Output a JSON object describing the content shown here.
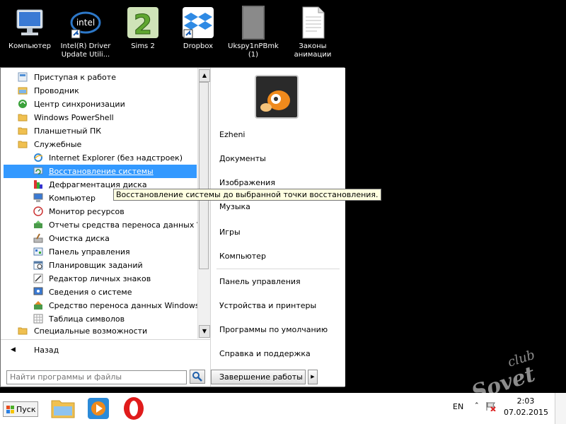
{
  "desktop": {
    "icons": [
      {
        "label": "Компьютер",
        "icon": "computer-icon"
      },
      {
        "label": "Intel(R) Driver\nUpdate Utili...",
        "icon": "intel-icon"
      },
      {
        "label": "Sims 2",
        "icon": "sims2-icon"
      },
      {
        "label": "Dropbox",
        "icon": "dropbox-icon"
      },
      {
        "label": "Ukspy1nPBmk\n(1)",
        "icon": "image-file-icon"
      },
      {
        "label": "Законы\nанимации",
        "icon": "document-icon"
      }
    ]
  },
  "start_menu": {
    "programs": [
      {
        "label": "Приступая к работе",
        "icon": "getting-started-icon"
      },
      {
        "label": "Проводник",
        "icon": "explorer-folder-icon"
      },
      {
        "label": "Центр синхронизации",
        "icon": "sync-center-icon"
      },
      {
        "label": "Windows PowerShell",
        "icon": "folder-icon"
      },
      {
        "label": "Планшетный ПК",
        "icon": "folder-icon"
      },
      {
        "label": "Служебные",
        "icon": "folder-icon"
      },
      {
        "label": "Internet Explorer (без надстроек)",
        "icon": "ie-icon"
      },
      {
        "label": "Восстановление системы",
        "icon": "system-restore-icon"
      },
      {
        "label": "Дефрагментация диска",
        "icon": "defrag-icon"
      },
      {
        "label": "Компьютер",
        "icon": "computer-icon"
      },
      {
        "label": "Монитор ресурсов",
        "icon": "resource-monitor-icon"
      },
      {
        "label": "Отчеты средства переноса данных Wir",
        "icon": "transfer-report-icon"
      },
      {
        "label": "Очистка диска",
        "icon": "disk-cleanup-icon"
      },
      {
        "label": "Панель управления",
        "icon": "control-panel-icon"
      },
      {
        "label": "Планировщик заданий",
        "icon": "task-scheduler-icon"
      },
      {
        "label": "Редактор личных знаков",
        "icon": "char-editor-icon"
      },
      {
        "label": "Сведения о системе",
        "icon": "system-info-icon"
      },
      {
        "label": "Средство переноса данных Windows",
        "icon": "easy-transfer-icon"
      },
      {
        "label": "Таблица символов",
        "icon": "char-map-icon"
      },
      {
        "label": "Специальные возможности",
        "icon": "folder-icon"
      }
    ],
    "back_label": "Назад",
    "search_placeholder": "Найти программы и файлы",
    "tooltip": "Восстановление системы до выбранной точки восстановления.",
    "right_items": [
      "Ezheni",
      "Документы",
      "Изображения",
      "Музыка",
      "Игры",
      "Компьютер",
      "Панель управления",
      "Устройства и принтеры",
      "Программы по умолчанию",
      "Справка и поддержка"
    ],
    "shutdown_label": "Завершение работы"
  },
  "taskbar": {
    "start_label": "Пуск",
    "pinned": [
      "explorer-icon",
      "media-player-icon",
      "opera-icon"
    ],
    "language": "EN",
    "time": "2:03",
    "date": "07.02.2015"
  },
  "watermark": {
    "line1": "club",
    "line2": "Sovet"
  }
}
